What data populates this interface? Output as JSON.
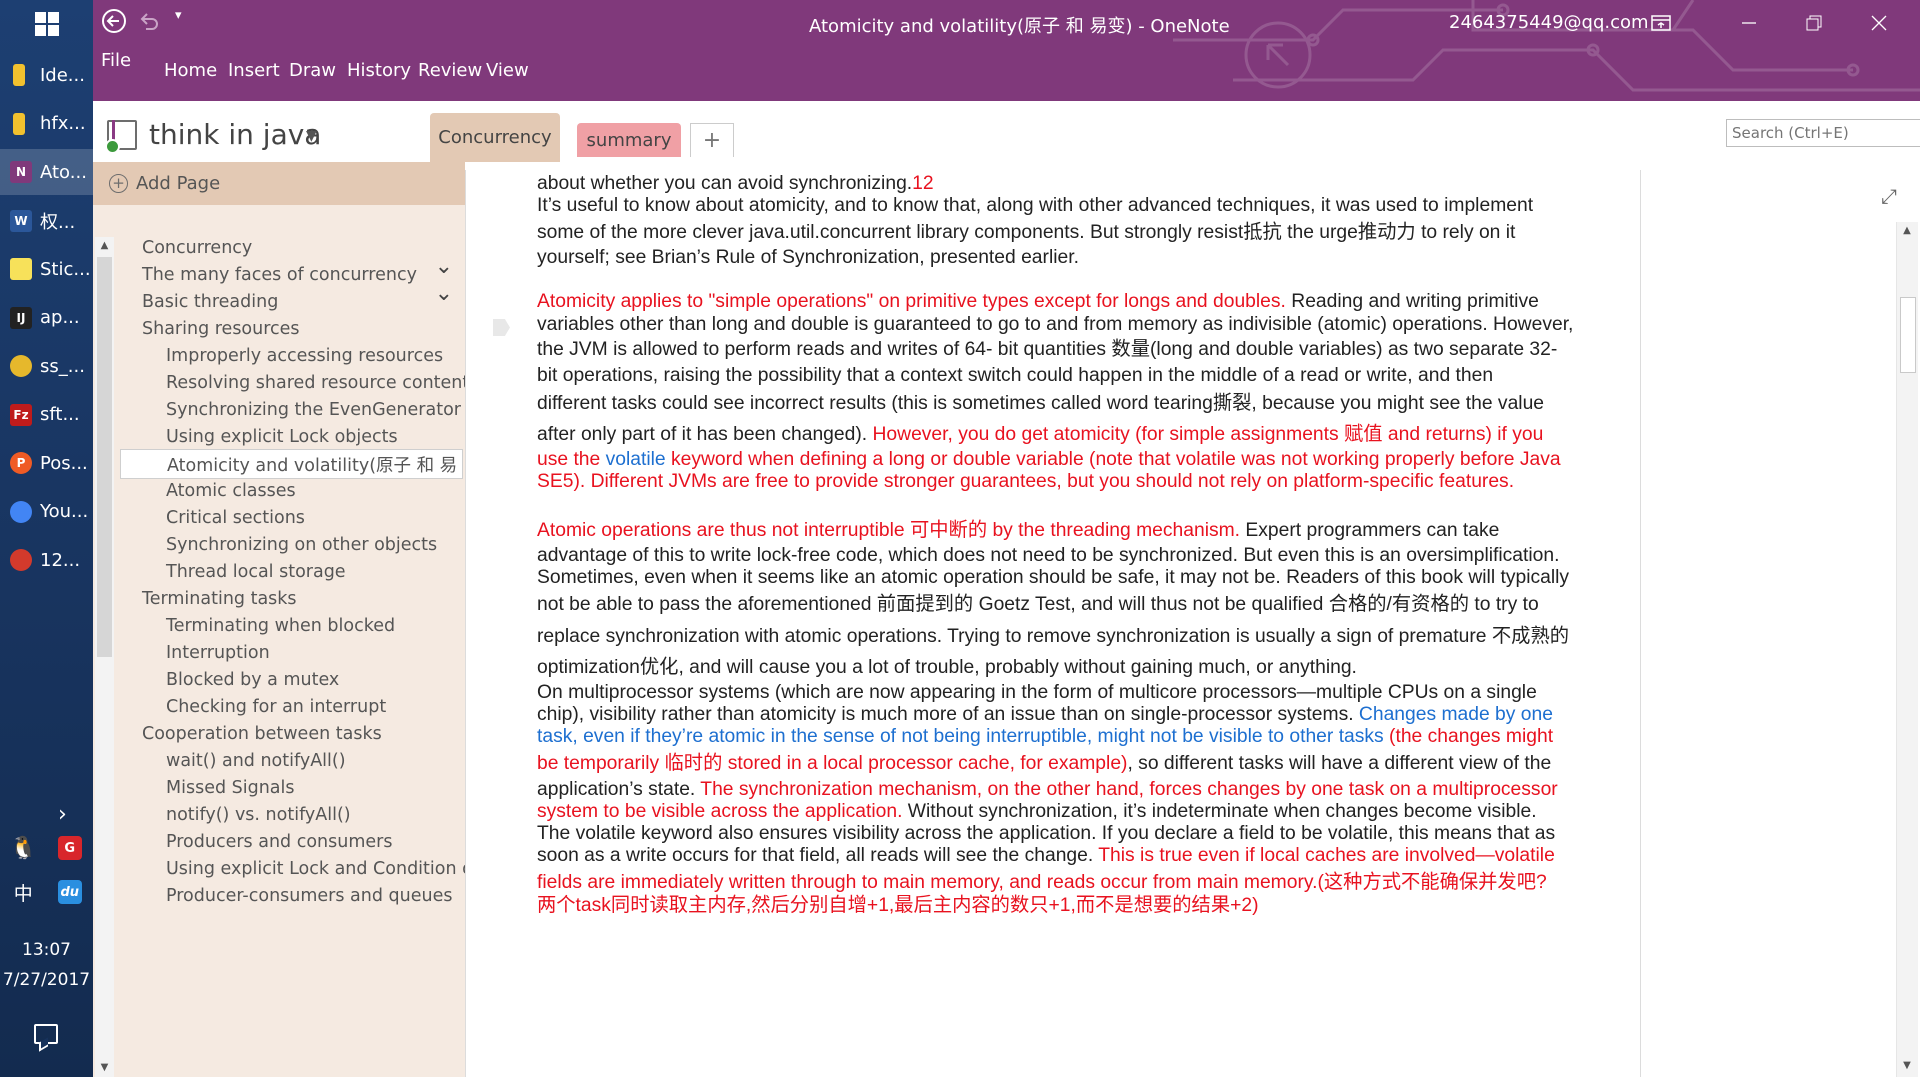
{
  "taskbar": {
    "apps": [
      {
        "label": "Ide...",
        "icon": "folder-icon",
        "color": "#f2c12e"
      },
      {
        "label": "hfx...",
        "icon": "folder-icon",
        "color": "#f2c12e"
      },
      {
        "label": "Ato...",
        "icon": "onenote-icon",
        "color": "#80397b",
        "active": true
      },
      {
        "label": "权...",
        "icon": "word-icon",
        "color": "#2b579a"
      },
      {
        "label": "Stic...",
        "icon": "sticky-notes-icon",
        "color": "#f7e15a"
      },
      {
        "label": "ap...",
        "icon": "intellij-icon",
        "color": "#222222"
      },
      {
        "label": "ss_...",
        "icon": "shadowsocks-icon",
        "color": "#e6b82c"
      },
      {
        "label": "sft...",
        "icon": "filezilla-icon",
        "color": "#bf1b1b"
      },
      {
        "label": "Pos...",
        "icon": "postman-icon",
        "color": "#ef5b25"
      },
      {
        "label": "You...",
        "icon": "chrome-icon",
        "color": "#4285f4"
      },
      {
        "label": "12...",
        "icon": "wechat-icon",
        "color": "#d33a2c"
      }
    ],
    "ime_label": "中",
    "baidu_label": "du",
    "time": "13:07",
    "date": "7/27/2017"
  },
  "window": {
    "title": "Atomicity and volatility(原子 和 易变)  -  OneNote",
    "account": "2464375449@qq.com",
    "menu": [
      "File",
      "Home",
      "Insert",
      "Draw",
      "History",
      "Review",
      "View"
    ]
  },
  "notebook": {
    "name": "think in java",
    "sections": [
      {
        "label": "Concurrency",
        "color": "#e3c9b4",
        "active": true
      },
      {
        "label": "summary",
        "color": "#f0a0a5"
      }
    ],
    "add_tab": "+"
  },
  "search": {
    "placeholder": "Search (Ctrl+E)"
  },
  "pages": {
    "add_page": "Add Page",
    "items": [
      {
        "label": "Concurrency",
        "level": 0
      },
      {
        "label": "The many faces of concurrency",
        "level": 0,
        "collapsible": true
      },
      {
        "label": "Basic threading",
        "level": 0,
        "collapsible": true
      },
      {
        "label": "Sharing resources",
        "level": 0
      },
      {
        "label": "Improperly accessing resources",
        "level": 1
      },
      {
        "label": "Resolving shared resource contenti",
        "level": 1
      },
      {
        "label": "Synchronizing the EvenGenerator",
        "level": 1
      },
      {
        "label": "Using explicit Lock objects",
        "level": 1
      },
      {
        "label": "Atomicity and volatility(原子 和 易",
        "level": 1,
        "selected": true
      },
      {
        "label": "Atomic classes",
        "level": 1
      },
      {
        "label": "Critical sections",
        "level": 1
      },
      {
        "label": "Synchronizing on other objects",
        "level": 1
      },
      {
        "label": "Thread local storage",
        "level": 1
      },
      {
        "label": "Terminating tasks",
        "level": 0
      },
      {
        "label": "Terminating when blocked",
        "level": 1
      },
      {
        "label": "Interruption",
        "level": 1
      },
      {
        "label": "Blocked by a mutex",
        "level": 1
      },
      {
        "label": "Checking for an interrupt",
        "level": 1
      },
      {
        "label": "Cooperation between tasks",
        "level": 0
      },
      {
        "label": "wait() and notifyAll()",
        "level": 1
      },
      {
        "label": "Missed Signals",
        "level": 1
      },
      {
        "label": "notify() vs. notifyAll()",
        "level": 1
      },
      {
        "label": "Producers and consumers",
        "level": 1
      },
      {
        "label": "Using explicit Lock and Condition o",
        "level": 1
      },
      {
        "label": "Producer-consumers and queues",
        "level": 1
      }
    ]
  },
  "note": {
    "lines": [
      [
        {
          "t": "about whether you can avoid synchronizing."
        },
        {
          "t": "12",
          "c": "red"
        }
      ],
      [
        {
          "t": "It’s useful to know about atomicity, and to know that, along with other advanced techniques, it was used to implement"
        }
      ],
      [
        {
          "t": "some of the more clever java.util.concurrent library components. But strongly resist抵抗 the urge推动力 to rely on it"
        }
      ],
      [
        {
          "t": "yourself; see Brian’s Rule of Synchronization, presented earlier."
        }
      ],
      [
        {
          "t": "Atomicity applies to \"simple operations\" on primitive types except for longs and doubles.",
          "c": "red"
        },
        {
          "t": " Reading and writing primitive"
        }
      ],
      [
        {
          "t": "variables other than long and double is guaranteed to go to and from memory as indivisible (atomic) operations. However,"
        }
      ],
      [
        {
          "t": "the JVM is allowed to perform reads and writes of 64- bit quantities 数量(long and double variables) as two separate 32-"
        }
      ],
      [
        {
          "t": "bit operations, raising the possibility that a context switch could happen in the middle of a read or write, and then"
        }
      ],
      [
        {
          "t": "different tasks could see incorrect results (this is sometimes called word tearing撕裂, because you might see the value"
        }
      ],
      [
        {
          "t": "after only part of it has been changed). "
        },
        {
          "t": "However, you do get atomicity (for simple assignments 赋值 and returns) if you",
          "c": "red"
        }
      ],
      [
        {
          "t": "use the ",
          "c": "red"
        },
        {
          "t": "volatile",
          "c": "blue"
        },
        {
          "t": " keyword when defining a long or double variable (note that volatile was not working properly before Java",
          "c": "red"
        }
      ],
      [
        {
          "t": "SE5). Different JVMs are free to provide stronger guarantees, but you should not rely on platform-specific features.",
          "c": "red"
        }
      ],
      [
        {
          "t": "Atomic operations are thus not interruptible 可中断的 by the threading mechanism.",
          "c": "red"
        },
        {
          "t": " Expert programmers can take"
        }
      ],
      [
        {
          "t": "advantage of this to write lock-free code, which does not need to be synchronized. But even this is an oversimplification."
        }
      ],
      [
        {
          "t": "Sometimes, even when it seems like an atomic operation should be safe, it may not be. Readers of this book will typically"
        }
      ],
      [
        {
          "t": "not be able to pass the aforementioned 前面提到的 Goetz Test, and will thus not be qualified 合格的/有资格的 to try to"
        }
      ],
      [
        {
          "t": "replace synchronization with atomic operations. Trying to remove synchronization is usually a sign of premature 不成熟的"
        }
      ],
      [
        {
          "t": "optimization优化, and will cause you a lot of trouble, probably without gaining much, or anything."
        }
      ],
      [
        {
          "t": "On multiprocessor systems (which are now appearing in the form of multicore processors—multiple CPUs on a single"
        }
      ],
      [
        {
          "t": "chip), visibility rather than atomicity is much more of an issue than on single-processor systems. "
        },
        {
          "t": "Changes made by one",
          "c": "blue"
        }
      ],
      [
        {
          "t": "task, even if they’re atomic in the sense of not being interruptible, might not be visible to other tasks",
          "c": "blue"
        },
        {
          "t": " (the changes might",
          "c": "red"
        }
      ],
      [
        {
          "t": "be temporarily 临时的 stored in a local processor cache, for example)",
          "c": "red"
        },
        {
          "t": ", so different tasks will have a different view of the"
        }
      ],
      [
        {
          "t": "application’s state. "
        },
        {
          "t": "The synchronization mechanism, on the other hand, forces changes by one task on a multiprocessor",
          "c": "red"
        }
      ],
      [
        {
          "t": "system to be visible across the application.",
          "c": "red"
        },
        {
          "t": " Without synchronization, it’s indeterminate when changes become visible."
        }
      ],
      [
        {
          "t": "The volatile keyword also ensures visibility across the application. If you declare a field to be volatile, this means that as"
        }
      ],
      [
        {
          "t": "soon as a write occurs for that field, all reads will see the change. "
        },
        {
          "t": "This is true even if local caches are involved—volatile",
          "c": "red"
        }
      ],
      [
        {
          "t": "fields are immediately written through to main memory, and reads occur from main memory.(这种方式不能确保并发吧?",
          "c": "red"
        }
      ],
      [
        {
          "t": "两个task同时读取主内存,然后分别自增+1,最后主内容的数只+1,而不是想要的结果+2)",
          "c": "red"
        }
      ]
    ]
  }
}
